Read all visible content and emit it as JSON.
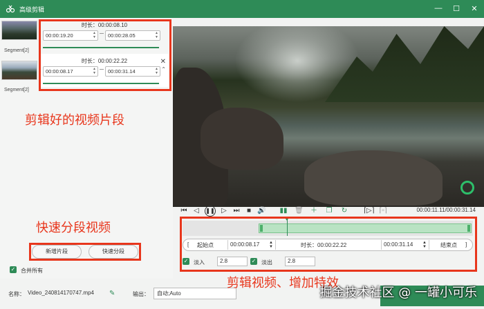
{
  "window": {
    "title": "高级剪辑"
  },
  "segments": [
    {
      "thumb_label": "Segment[2]",
      "duration": "时长：00:00:08.10",
      "start": "00:00:19.20",
      "end": "00:00:28.05"
    },
    {
      "thumb_label": "Segment[2]",
      "duration": "时长：00:00:22.22",
      "start": "00:00:08.17",
      "end": "00:00:31.14"
    }
  ],
  "annotations": {
    "segments_note": "剪辑好的视频片段",
    "split_note": "快速分段视频",
    "edit_note": "剪辑视频、增加特效"
  },
  "buttons": {
    "add_segment": "新增片段",
    "quick_split": "快速分段"
  },
  "merge_all": "合并所有",
  "player": {
    "time_info": "00:00:11.11/00:00:31.14"
  },
  "range": {
    "start_label": "起始点",
    "start_value": "00:00:08.17",
    "duration_label": "时长：00:00:22.22",
    "end_value": "00:00:31.14",
    "end_label": "结束点"
  },
  "fade": {
    "in_label": "淡入",
    "in_value": "2.8",
    "out_label": "淡出",
    "out_value": "2.8"
  },
  "footer": {
    "name_label": "名称：",
    "name_value": "Video_240814170747.mp4",
    "output_label": "输出：",
    "output_value": "自动;Auto",
    "watermark": "掘金技术社区 @ 一罐小可乐"
  },
  "colors": {
    "accent": "#2e8b57",
    "annotation": "#e8361c"
  }
}
